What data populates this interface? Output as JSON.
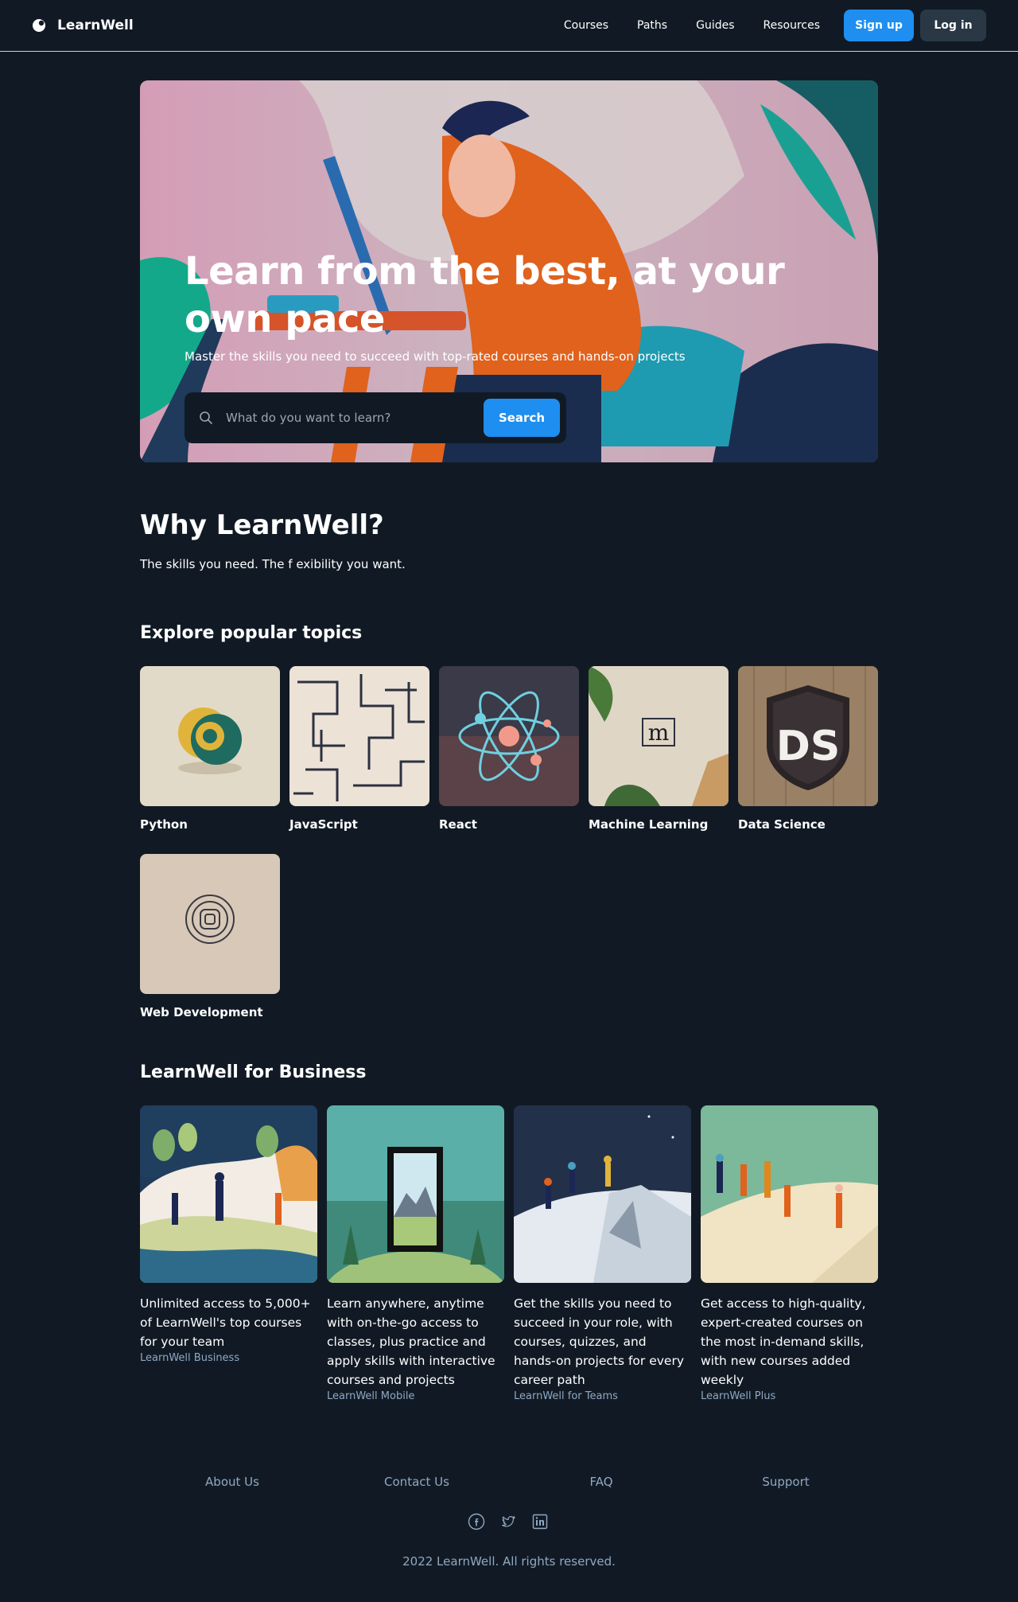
{
  "nav": {
    "brand": "LearnWell",
    "links": [
      "Courses",
      "Paths",
      "Guides",
      "Resources"
    ],
    "signup": "Sign up",
    "login": "Log in"
  },
  "hero": {
    "title": "Learn from the best, at your own pace",
    "subtitle": "Master the skills you need to succeed with top-rated courses and hands-on projects",
    "search_placeholder": "What do you want to learn?",
    "search_button": "Search"
  },
  "why": {
    "title": "Why LearnWell?",
    "subtitle": "The skills you need. The f exibility you want."
  },
  "topics": {
    "title": "Explore popular topics",
    "items": [
      {
        "label": "Python",
        "icon": "python-icon"
      },
      {
        "label": "JavaScript",
        "icon": "javascript-icon"
      },
      {
        "label": "React",
        "icon": "react-atom-icon"
      },
      {
        "label": "Machine Learning",
        "icon": "machine-learning-icon"
      },
      {
        "label": "Data Science",
        "icon": "data-science-icon"
      },
      {
        "label": "Web Development",
        "icon": "web-development-icon"
      }
    ]
  },
  "business": {
    "title": "LearnWell for Business",
    "items": [
      {
        "text": "Unlimited access to 5,000+ of LearnWell's top courses for your team",
        "tag": "LearnWell Business"
      },
      {
        "text": "Learn anywhere, anytime with on-the-go access to classes, plus practice and apply skills with interactive courses and projects",
        "tag": "LearnWell Mobile"
      },
      {
        "text": "Get the skills you need to succeed in your role, with courses, quizzes, and hands-on projects for every career path",
        "tag": "LearnWell for Teams"
      },
      {
        "text": "Get access to high-quality, expert-created courses on the most in-demand skills, with new courses added weekly",
        "tag": "LearnWell Plus"
      }
    ]
  },
  "footer": {
    "links": [
      "About Us",
      "Contact Us",
      "FAQ",
      "Support"
    ],
    "social": [
      "facebook-icon",
      "twitter-icon",
      "linkedin-icon"
    ],
    "copyright": "2022 LearnWell. All rights reserved."
  },
  "colors": {
    "background": "#111a24",
    "accent": "#1e8ef0",
    "muted_text": "#8fa8c4",
    "secondary_button": "#2a3846"
  }
}
